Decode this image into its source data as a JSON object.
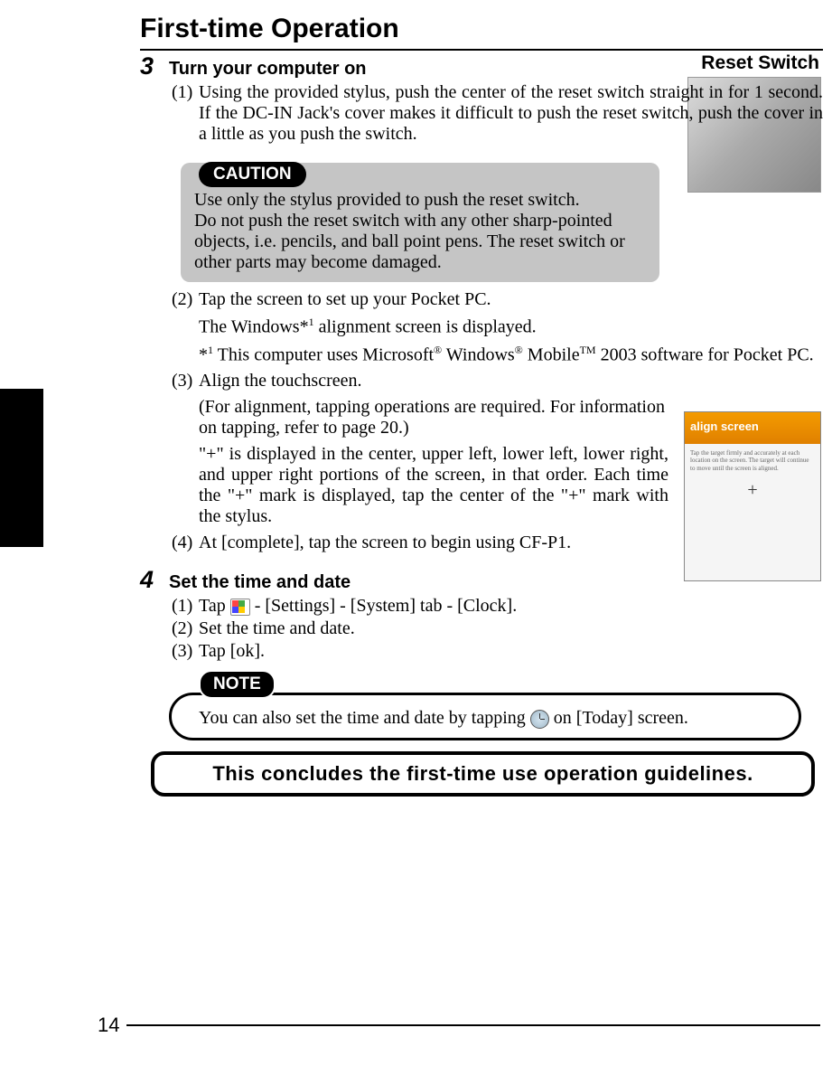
{
  "page_title": "First-time Operation",
  "reset_label": "Reset Switch",
  "step3": {
    "num": "3",
    "title": "Turn your computer on",
    "p1_num": "(1)",
    "p1_text": "Using the provided stylus, push the center of the reset switch straight in for 1 second. If the DC-IN Jack's cover makes it difficult to push the reset switch, push the cover in a little as you push the switch.",
    "caution_label": "CAUTION",
    "caution_l1": "Use only the stylus provided to push the reset switch.",
    "caution_l2": "Do not push the reset switch with any other sharp-pointed objects, i.e. pencils, and ball point pens. The reset switch or other parts may become damaged.",
    "p2_num": "(2)",
    "p2_text": "Tap the screen to set up your Pocket PC.",
    "p2b_a": "The Windows*",
    "p2b_sup": "1",
    "p2b_b": " alignment screen is displayed.",
    "p2c_a": "*",
    "p2c_sup": "1",
    "p2c_b": " This computer uses Microsoft",
    "p2c_c": " Windows",
    "p2c_d": " Mobile",
    "p2c_e": " 2003 software for Pocket PC.",
    "p3_num": "(3)",
    "p3_text": "Align the touchscreen.",
    "p3b": "(For alignment, tapping operations are required.  For information on tapping, refer to page 20.)",
    "p3c": "\"+\" is displayed in the center, upper left, lower left, lower right, and upper right portions of the screen, in that order. Each time the \"+\" mark is displayed, tap the center of the \"+\" mark with the stylus.",
    "p4_num": "(4)",
    "p4_text": "At [complete], tap the screen to begin using CF-P1."
  },
  "step4": {
    "num": "4",
    "title": "Set the time and date",
    "p1_num": "(1)",
    "p1_a": "Tap ",
    "p1_b": " - [Settings] - [System] tab - [Clock].",
    "p2_num": "(2)",
    "p2_text": "Set the time and date.",
    "p3_num": "(3)",
    "p3_text": "Tap [ok]."
  },
  "note_label": "NOTE",
  "note_a": "You can also set the time and date by tapping ",
  "note_b": " on [Today] screen.",
  "conclude_text": "This concludes the first-time use operation guidelines.",
  "align_header": "align screen",
  "align_body": "Tap the target firmly and accurately at each location on the screen. The target will continue to move until the screen is aligned.",
  "page_num": "14"
}
